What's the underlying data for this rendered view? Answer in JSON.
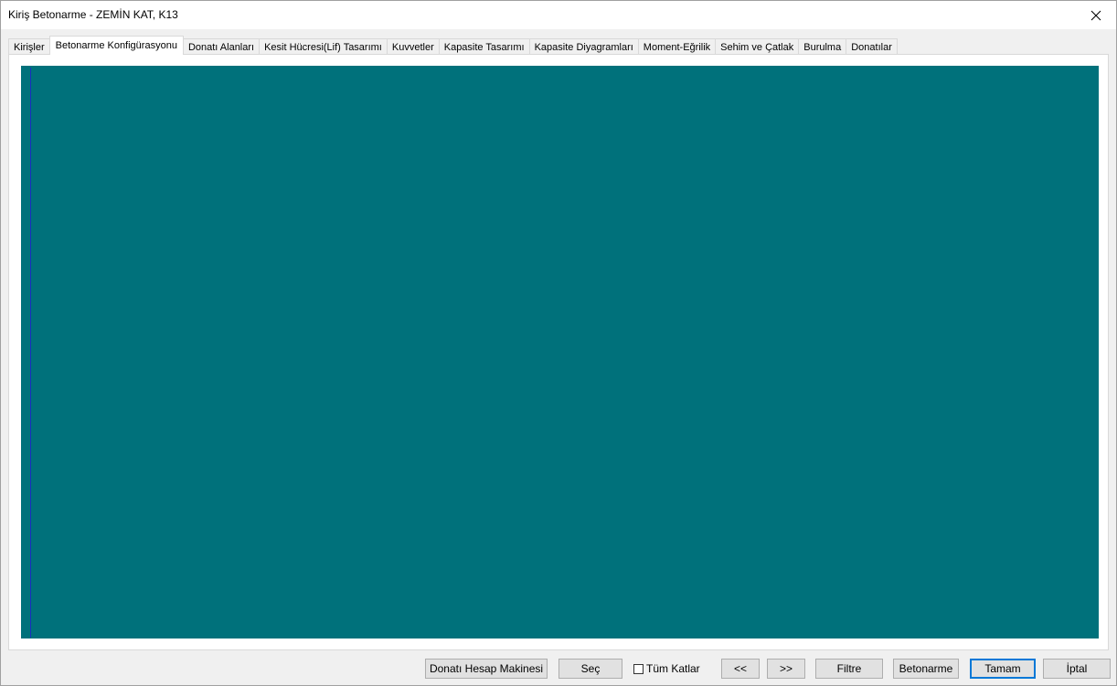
{
  "window": {
    "title": "Kiriş Betonarme - ZEMİN KAT, K13"
  },
  "tabs": [
    {
      "label": "Kirişler"
    },
    {
      "label": "Betonarme Konfigürasyonu",
      "active": true
    },
    {
      "label": "Donatı Alanları"
    },
    {
      "label": "Kesit Hücresi(Lif) Tasarımı"
    },
    {
      "label": "Kuvvetler"
    },
    {
      "label": "Kapasite Tasarımı"
    },
    {
      "label": "Kapasite Diyagramları"
    },
    {
      "label": "Moment-Eğrilik"
    },
    {
      "label": "Sehim ve Çatlak"
    },
    {
      "label": "Burulma"
    },
    {
      "label": "Donatılar"
    }
  ],
  "canvas": {
    "background": "#00717b",
    "line_color": "#1a2fbf"
  },
  "footer": {
    "calculator_label": "Donatı Hesap Makinesi",
    "select_label": "Seç",
    "all_floors_label": "Tüm Katlar",
    "all_floors_checked": false,
    "prev_label": "<<",
    "next_label": ">>",
    "filter_label": "Filtre",
    "concrete_label": "Betonarme",
    "ok_label": "Tamam",
    "cancel_label": "İptal"
  },
  "icons": {
    "close": "close-icon"
  }
}
